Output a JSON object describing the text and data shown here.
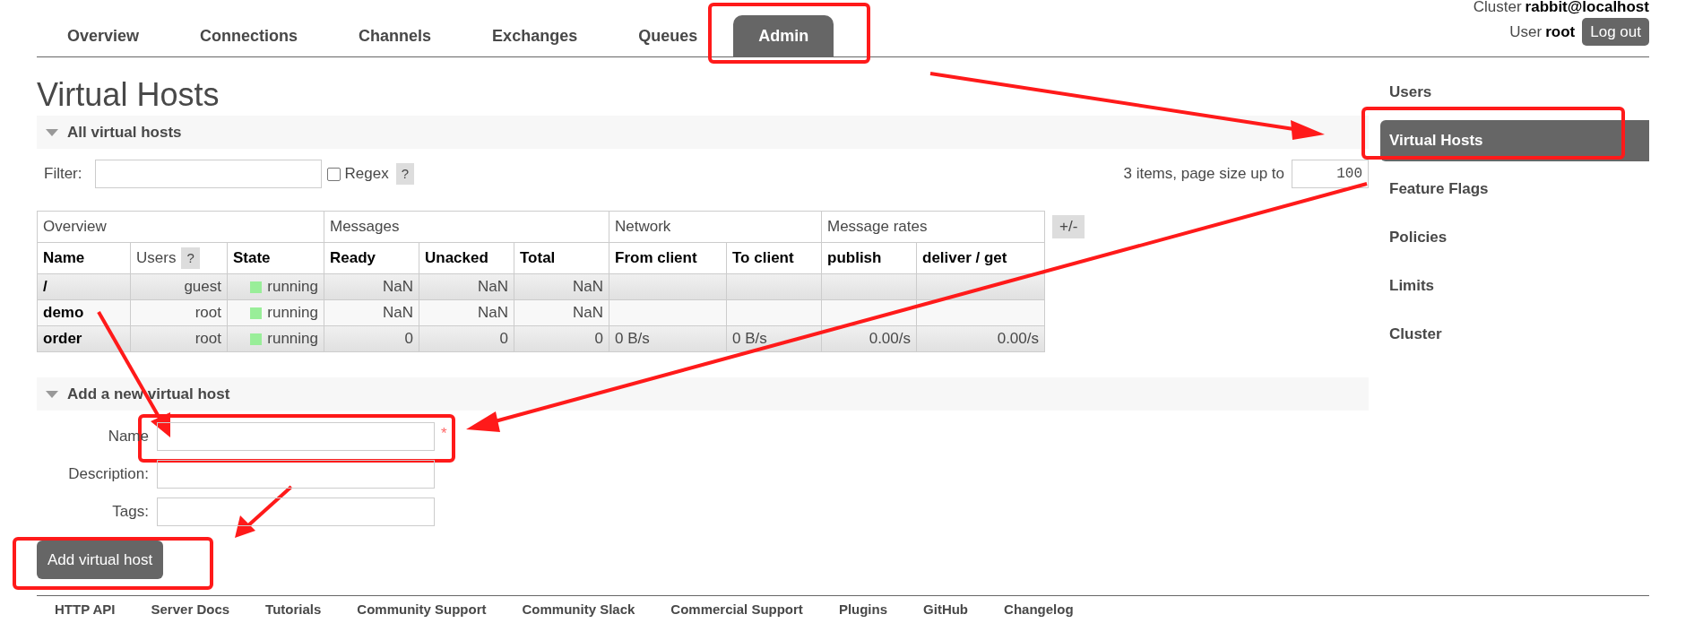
{
  "header": {
    "cluster_label": "Cluster",
    "cluster": "rabbit@localhost",
    "user_label": "User",
    "user": "root",
    "logout": "Log out"
  },
  "tabs": [
    {
      "label": "Overview",
      "selected": false
    },
    {
      "label": "Connections",
      "selected": false
    },
    {
      "label": "Channels",
      "selected": false
    },
    {
      "label": "Exchanges",
      "selected": false
    },
    {
      "label": "Queues",
      "selected": false
    },
    {
      "label": "Admin",
      "selected": true
    }
  ],
  "page_title": "Virtual Hosts",
  "all_hosts": {
    "title": "All virtual hosts",
    "expanded": true,
    "filter_label": "Filter:",
    "regex_label": "Regex",
    "regex_checked": false,
    "help": "?",
    "items_text": "3 items, page size up to",
    "page_size": "100",
    "column_toggle": "+/-",
    "table": {
      "groups": [
        {
          "label": "Overview",
          "columns": [
            {
              "label": "Name"
            },
            {
              "label": "Users",
              "help": "?"
            },
            {
              "label": "State"
            }
          ]
        },
        {
          "label": "Messages",
          "columns": [
            {
              "label": "Ready"
            },
            {
              "label": "Unacked"
            },
            {
              "label": "Total"
            }
          ]
        },
        {
          "label": "Network",
          "columns": [
            {
              "label": "From client"
            },
            {
              "label": "To client"
            }
          ]
        },
        {
          "label": "Message rates",
          "columns": [
            {
              "label": "publish"
            },
            {
              "label": "deliver / get"
            }
          ]
        }
      ],
      "rows": [
        {
          "name": "/",
          "users": "guest",
          "state": "running",
          "color": "#99ee99",
          "ready": "NaN",
          "unacked": "NaN",
          "total": "NaN"
        },
        {
          "name": "demo",
          "users": "root",
          "state": "running",
          "color": "#99ee99",
          "ready": "NaN",
          "unacked": "NaN",
          "total": "NaN"
        },
        {
          "name": "order",
          "users": "root",
          "state": "running",
          "color": "#99ee99",
          "ready": "0",
          "unacked": "0",
          "total": "0",
          "from_client": "0 B/s",
          "to_client": "0 B/s",
          "publish": "0.00/s",
          "deliver_get": "0.00/s"
        }
      ]
    }
  },
  "add_host": {
    "title": "Add a new virtual host",
    "expanded": true,
    "fields": [
      {
        "label": "Name",
        "required": true
      },
      {
        "label": "Description:",
        "required": false
      },
      {
        "label": "Tags:",
        "required": false
      }
    ],
    "required_mark": "*",
    "button": "Add virtual host"
  },
  "sidebar": {
    "items": [
      {
        "label": "Users",
        "selected": false
      },
      {
        "label": "Virtual Hosts",
        "selected": true
      },
      {
        "label": "Feature Flags",
        "selected": false
      },
      {
        "label": "Policies",
        "selected": false
      },
      {
        "label": "Limits",
        "selected": false
      },
      {
        "label": "Cluster",
        "selected": false
      }
    ]
  },
  "footer_links": [
    "HTTP API",
    "Server Docs",
    "Tutorials",
    "Community Support",
    "Community Slack",
    "Commercial Support",
    "Plugins",
    "GitHub",
    "Changelog"
  ]
}
